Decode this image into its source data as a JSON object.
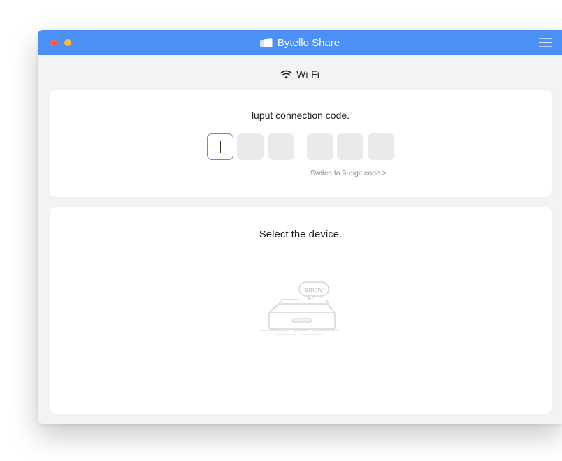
{
  "window": {
    "title": "Bytello Share",
    "accent_color": "#4a90f5",
    "traffic_lights": [
      "#fe5e57",
      "#febc2e"
    ],
    "title_icon": "folder-icon",
    "menu_icon": "hamburger-menu-icon"
  },
  "network": {
    "icon": "wifi-icon",
    "label": "Wi-Fi"
  },
  "connection_code": {
    "heading": "luput connection code.",
    "digits": [
      "",
      "",
      "",
      "",
      "",
      ""
    ],
    "active_digit_index": 0,
    "switch_link_label": "Switch to 9-digit code >"
  },
  "device_select": {
    "heading": "Select the device.",
    "empty_label": "empty",
    "empty_icon": "empty-tray-icon"
  }
}
